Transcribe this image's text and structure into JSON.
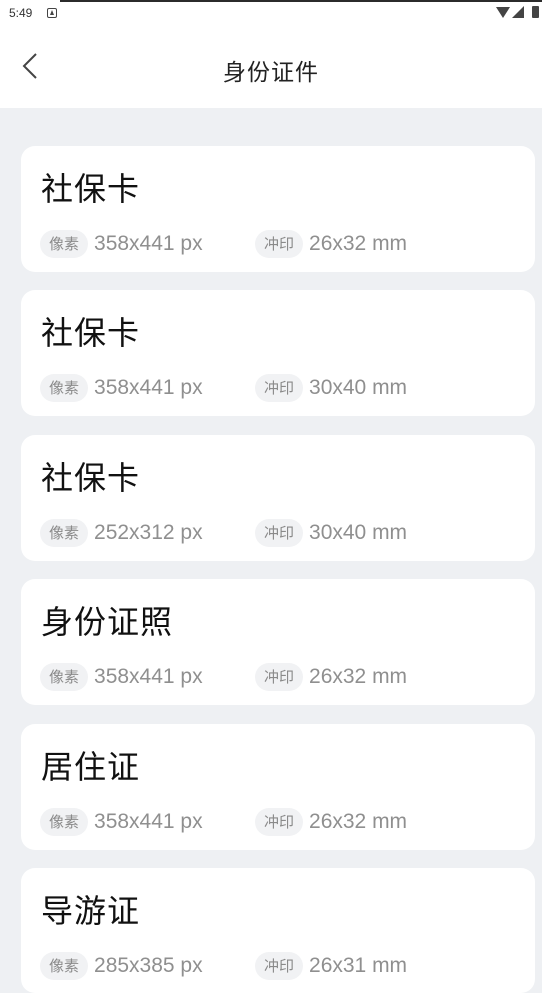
{
  "status_bar": {
    "time": "5:49"
  },
  "header": {
    "title": "身份证件"
  },
  "specs_labels": {
    "pixel": "像素",
    "print": "冲印"
  },
  "cards": [
    {
      "title": "社保卡",
      "pixel": "358x441 px",
      "print": "26x32 mm"
    },
    {
      "title": "社保卡",
      "pixel": "358x441 px",
      "print": "30x40 mm"
    },
    {
      "title": "社保卡",
      "pixel": "252x312 px",
      "print": "30x40 mm"
    },
    {
      "title": "身份证照",
      "pixel": "358x441 px",
      "print": "26x32 mm"
    },
    {
      "title": "居住证",
      "pixel": "358x441 px",
      "print": "26x32 mm"
    },
    {
      "title": "导游证",
      "pixel": "285x385 px",
      "print": "26x31 mm"
    }
  ]
}
